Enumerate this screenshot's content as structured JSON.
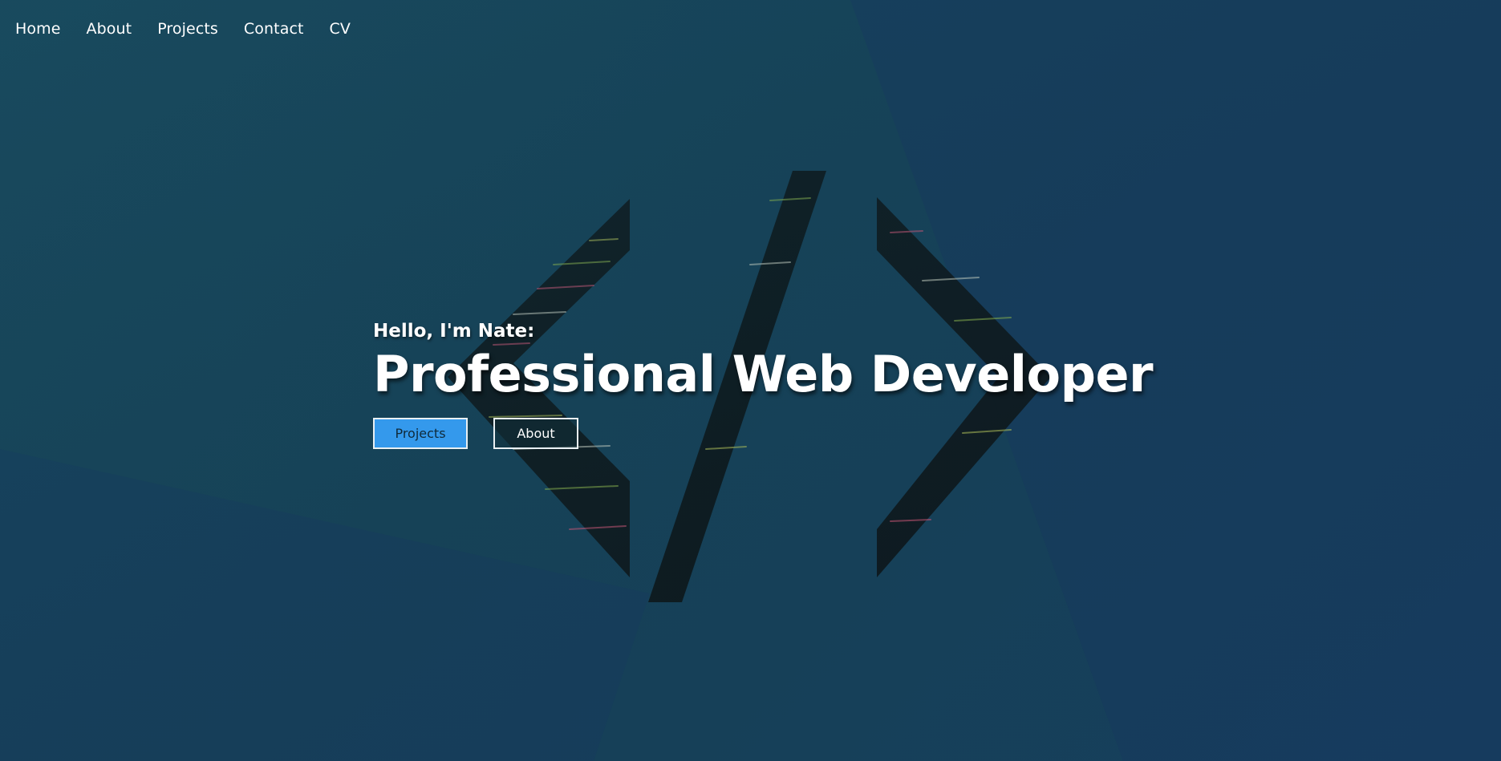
{
  "nav": {
    "items": [
      {
        "label": "Home"
      },
      {
        "label": "About"
      },
      {
        "label": "Projects"
      },
      {
        "label": "Contact"
      },
      {
        "label": "CV"
      }
    ]
  },
  "hero": {
    "intro": "Hello, I'm Nate:",
    "headline": "Professional Web Developer",
    "buttons": {
      "primary_label": "Projects",
      "secondary_label": "About"
    }
  },
  "colors": {
    "background": "#17465a",
    "accent": "#3499ec",
    "text": "#ffffff"
  },
  "background_art": {
    "icon": "code-brackets-icon"
  }
}
